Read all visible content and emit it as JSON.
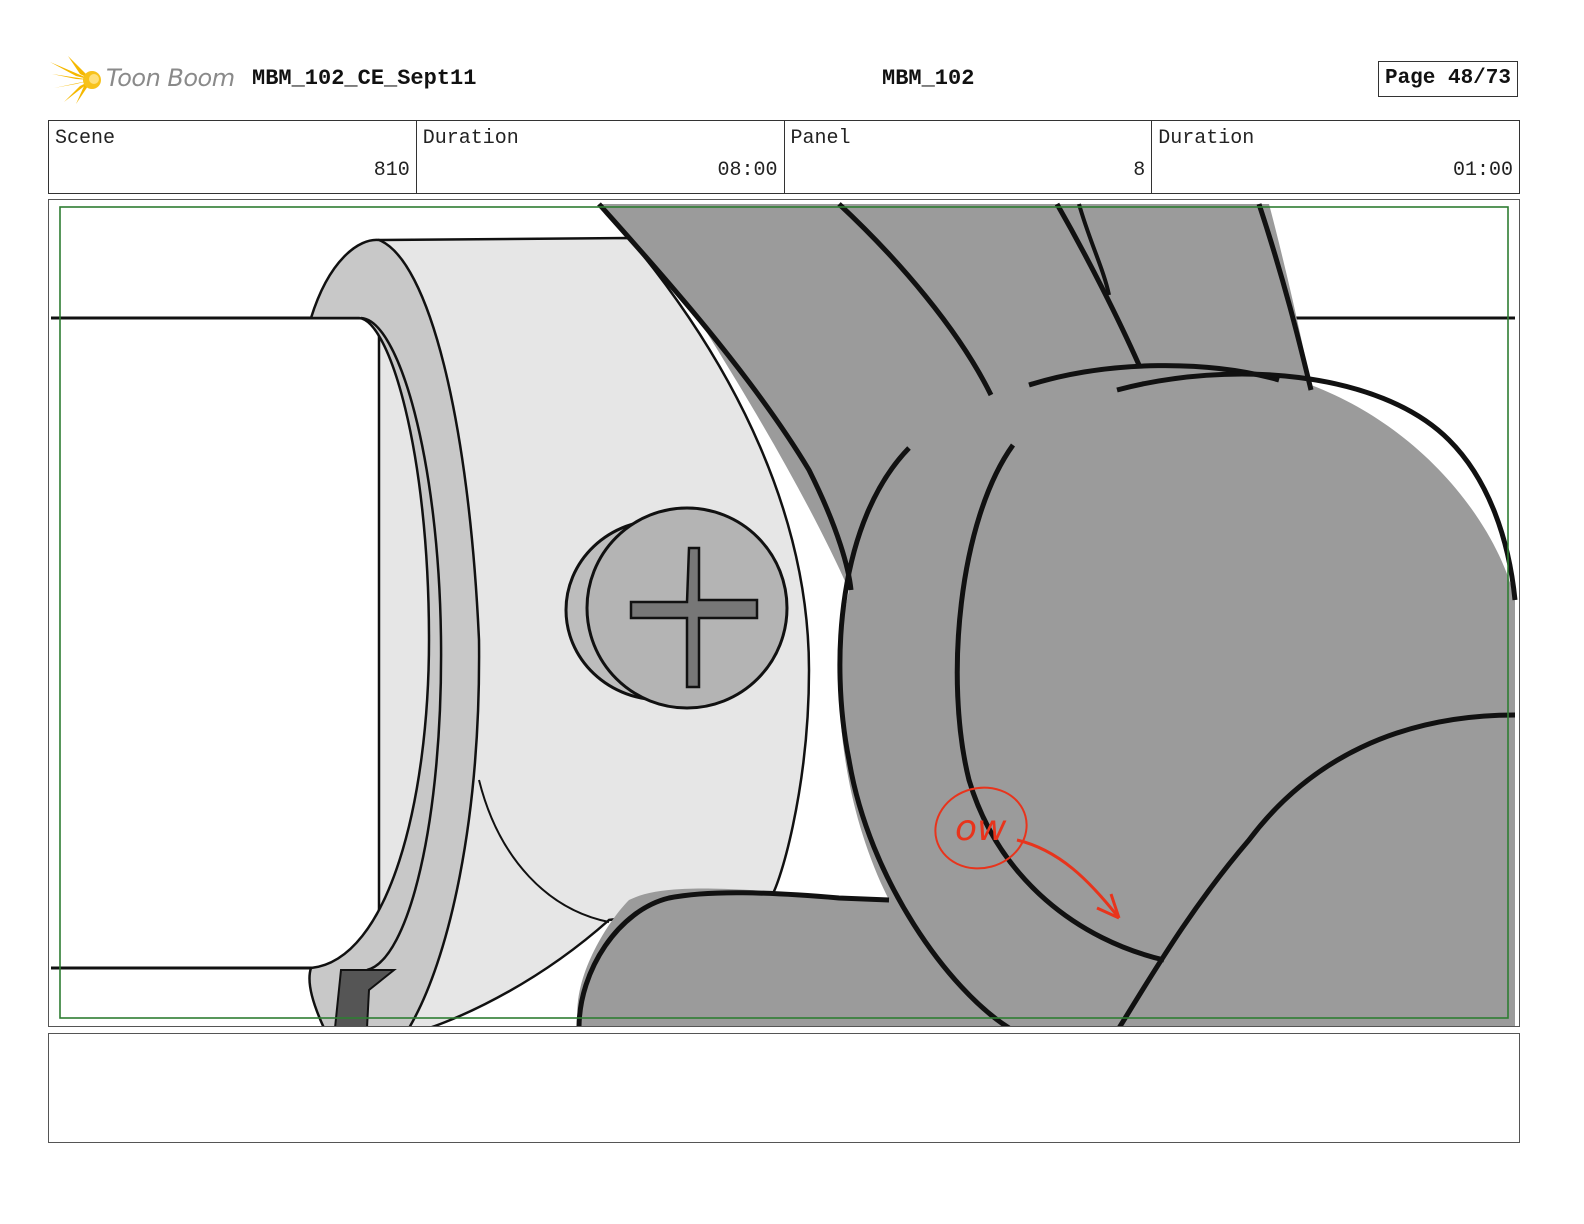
{
  "header": {
    "logo_text": "Toon Boom",
    "project": "MBM_102_CE_Sept11",
    "episode": "MBM_102",
    "page": "Page 48/73"
  },
  "info": {
    "scene_label": "Scene",
    "scene_value": "810",
    "scene_duration_label": "Duration",
    "scene_duration_value": "08:00",
    "panel_label": "Panel",
    "panel_value": "8",
    "panel_duration_label": "Duration",
    "panel_duration_value": "01:00"
  },
  "panel_image": {
    "annotation_text": "ow",
    "colors": {
      "safe_area": "#2e7d32",
      "annotation": "#e8341c",
      "gray": "#9b9b9b"
    }
  },
  "notes": {
    "text": ""
  }
}
